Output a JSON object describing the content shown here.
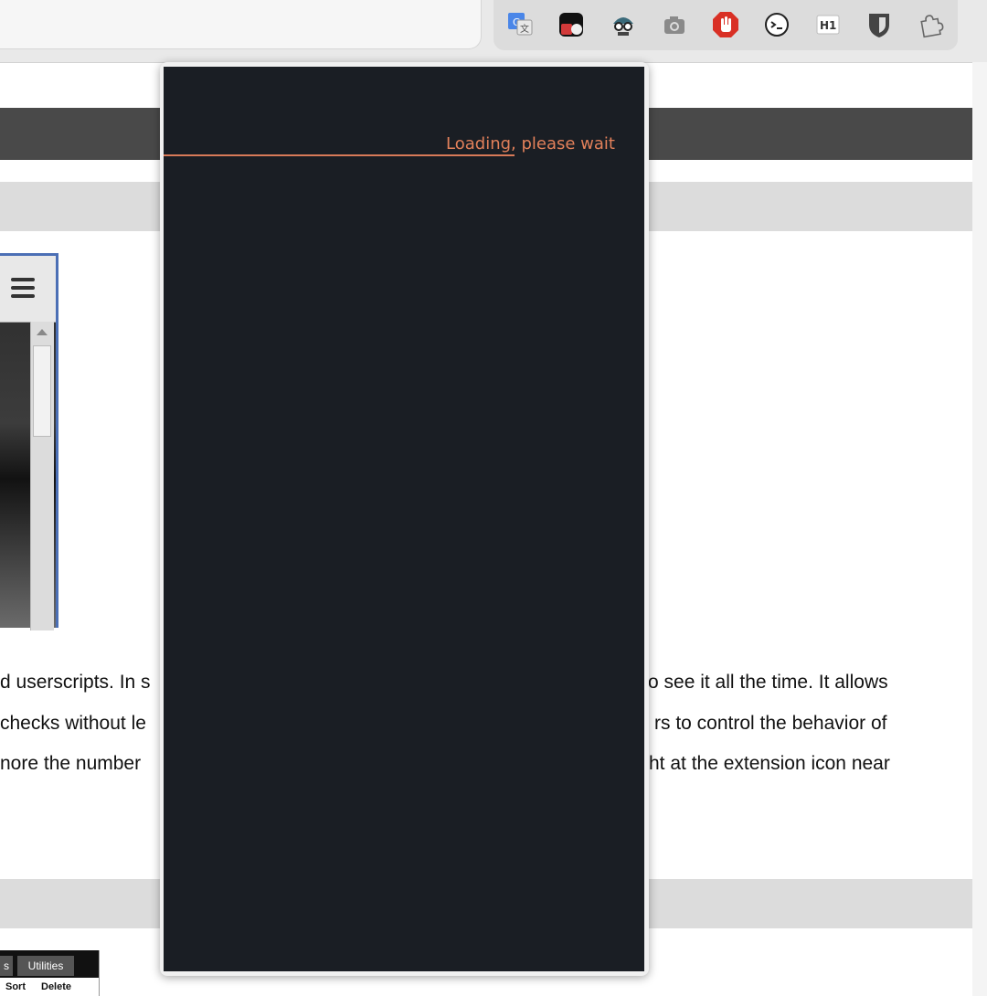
{
  "extensions": [
    {
      "name": "google-translate-icon"
    },
    {
      "name": "extension-dice-icon"
    },
    {
      "name": "spy-glasses-icon"
    },
    {
      "name": "camera-icon"
    },
    {
      "name": "stop-hand-icon"
    },
    {
      "name": "console-face-icon"
    },
    {
      "name": "h1-icon",
      "label": "H1"
    },
    {
      "name": "shield-icon"
    },
    {
      "name": "puzzle-icon"
    }
  ],
  "popup": {
    "loading_text": "Loading, please wait",
    "progress": 0.73,
    "background": "#1a1e24",
    "accent": "#e2805a"
  },
  "page": {
    "lines": [
      "d userscripts. In s",
      "o see it all the time. It allows",
      "checks without le",
      "rs to control the behavior of",
      "nore the number",
      "ht at the extension icon near"
    ],
    "mini_tabs": [
      "s",
      "Utilities"
    ],
    "mini_row": [
      "Sort",
      "Delete"
    ]
  }
}
